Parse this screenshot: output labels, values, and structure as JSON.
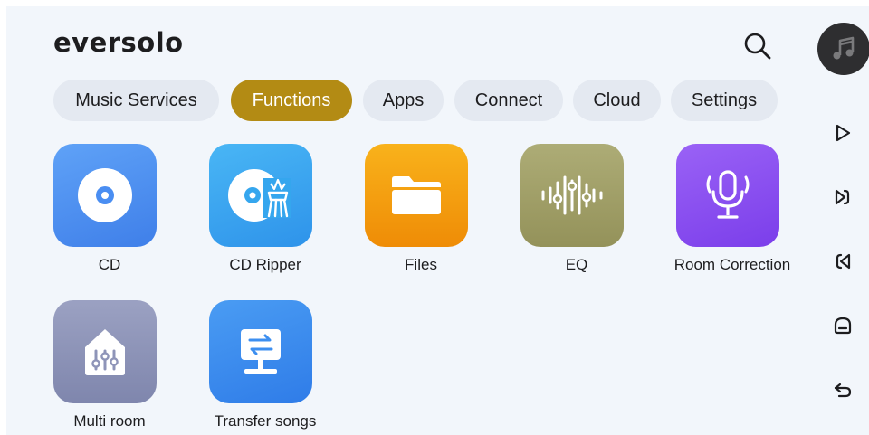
{
  "app": {
    "brand": "eversolo",
    "colors": {
      "accent": "#b38b14",
      "background": "#f2f6fb",
      "tab_inactive": "#e4e9f1"
    }
  },
  "header": {
    "search_icon": "search-icon"
  },
  "tabs": [
    {
      "label": "Music Services",
      "active": false
    },
    {
      "label": "Functions",
      "active": true
    },
    {
      "label": "Apps",
      "active": false
    },
    {
      "label": "Connect",
      "active": false
    },
    {
      "label": "Cloud",
      "active": false
    },
    {
      "label": "Settings",
      "active": false
    }
  ],
  "functions": [
    {
      "label": "CD",
      "icon": "cd-icon",
      "color": "#4a8ef2"
    },
    {
      "label": "CD Ripper",
      "icon": "cd-ripper-icon",
      "color": "#35a6ee"
    },
    {
      "label": "Files",
      "icon": "folder-icon",
      "color": "#f4a00e"
    },
    {
      "label": "EQ",
      "icon": "equalizer-icon",
      "color": "#a09f66"
    },
    {
      "label": "Room Correction",
      "icon": "microphone-icon",
      "color": "#8a4ef2"
    },
    {
      "label": "Multi room",
      "icon": "multi-room-icon",
      "color": "#8e94b8"
    },
    {
      "label": "Transfer songs",
      "icon": "transfer-icon",
      "color": "#3d8ff0"
    }
  ],
  "side_rail": [
    {
      "name": "now-playing",
      "icon": "music-note-icon"
    },
    {
      "name": "play",
      "icon": "play-icon"
    },
    {
      "name": "next",
      "icon": "next-icon"
    },
    {
      "name": "previous",
      "icon": "previous-icon"
    },
    {
      "name": "home",
      "icon": "home-icon"
    },
    {
      "name": "back",
      "icon": "back-icon"
    }
  ]
}
